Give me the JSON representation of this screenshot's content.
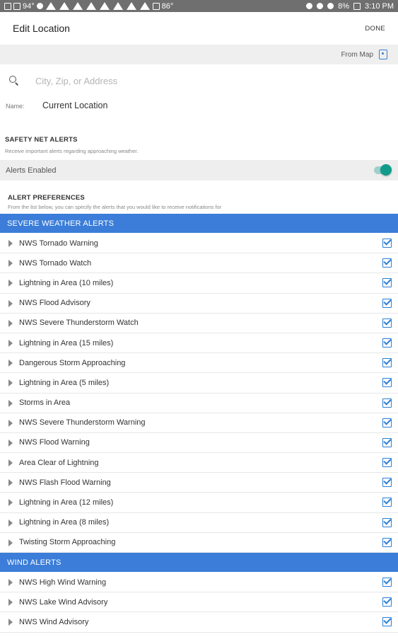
{
  "status_bar": {
    "temp_left": "94°",
    "temp_right": "86°",
    "battery": "8%",
    "time": "3:10 PM"
  },
  "app_bar": {
    "title": "Edit Location",
    "done_label": "DONE"
  },
  "map_row": {
    "label": "From Map",
    "icon": "map-icon"
  },
  "search": {
    "placeholder": "City, Zip, or Address",
    "value": "",
    "icon": "search-icon"
  },
  "name_field": {
    "label": "Name:",
    "value": "Current Location"
  },
  "safety_net": {
    "title": "SAFETY NET ALERTS",
    "description": "Receive important alerts regarding approaching weather.",
    "alerts_enabled_label": "Alerts Enabled",
    "alerts_enabled": true,
    "toggle_color": "#119b8a"
  },
  "alert_preferences": {
    "title": "ALERT PREFERENCES",
    "description": "From the list below, you can specify the alerts that you would like to receive notifications for"
  },
  "categories": [
    {
      "title": "SEVERE WEATHER ALERTS",
      "color": "#3b7dd8",
      "items": [
        {
          "label": "NWS Tornado Warning",
          "checked": true
        },
        {
          "label": "NWS Tornado Watch",
          "checked": true
        },
        {
          "label": "Lightning in Area (10 miles)",
          "checked": true
        },
        {
          "label": "NWS Flood Advisory",
          "checked": true
        },
        {
          "label": "NWS Severe Thunderstorm Watch",
          "checked": true
        },
        {
          "label": "Lightning in Area (15 miles)",
          "checked": true
        },
        {
          "label": "Dangerous Storm Approaching",
          "checked": true
        },
        {
          "label": "Lightning in Area (5 miles)",
          "checked": true
        },
        {
          "label": "Storms in Area",
          "checked": true
        },
        {
          "label": "NWS Severe Thunderstorm Warning",
          "checked": true
        },
        {
          "label": "NWS Flood Warning",
          "checked": true
        },
        {
          "label": "Area Clear of Lightning",
          "checked": true
        },
        {
          "label": "NWS Flash Flood Warning",
          "checked": true
        },
        {
          "label": "Lightning in Area (12 miles)",
          "checked": true
        },
        {
          "label": "Lightning in Area (8 miles)",
          "checked": true
        },
        {
          "label": "Twisting Storm Approaching",
          "checked": true
        }
      ]
    },
    {
      "title": "WIND ALERTS",
      "color": "#3b7dd8",
      "items": [
        {
          "label": "NWS High Wind Warning",
          "checked": true
        },
        {
          "label": "NWS Lake Wind Advisory",
          "checked": true
        },
        {
          "label": "NWS Wind Advisory",
          "checked": true
        }
      ]
    }
  ]
}
